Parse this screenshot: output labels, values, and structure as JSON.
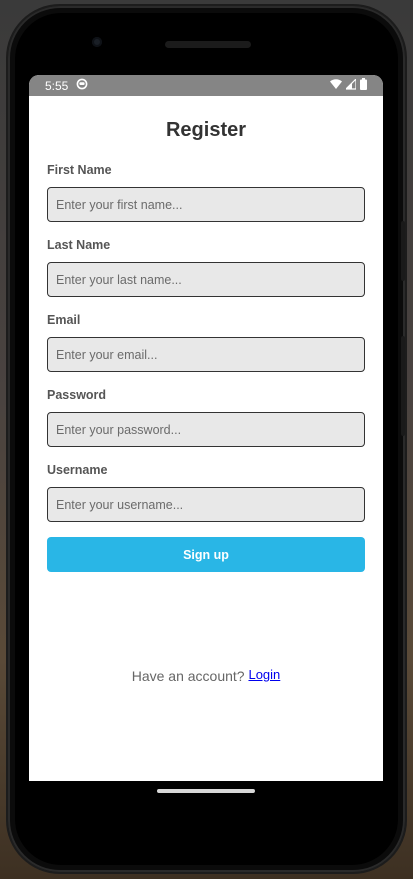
{
  "status_bar": {
    "time": "5:55"
  },
  "page": {
    "title": "Register"
  },
  "form": {
    "fields": [
      {
        "label": "First Name",
        "placeholder": "Enter your first name...",
        "value": ""
      },
      {
        "label": "Last Name",
        "placeholder": "Enter your last name...",
        "value": ""
      },
      {
        "label": "Email",
        "placeholder": "Enter your email...",
        "value": ""
      },
      {
        "label": "Password",
        "placeholder": "Enter your password...",
        "value": ""
      },
      {
        "label": "Username",
        "placeholder": "Enter your username...",
        "value": ""
      }
    ],
    "submit_label": "Sign up"
  },
  "footer": {
    "prompt": "Have an account?",
    "login_label": "Login"
  },
  "colors": {
    "accent": "#29b6e6",
    "status_bar_bg": "#858585",
    "input_bg": "#e8e8e8",
    "link": "#0000ee"
  },
  "icons": {
    "status_app": "app-notification-icon",
    "wifi": "wifi-icon",
    "signal": "cell-signal-icon",
    "battery": "battery-icon"
  }
}
